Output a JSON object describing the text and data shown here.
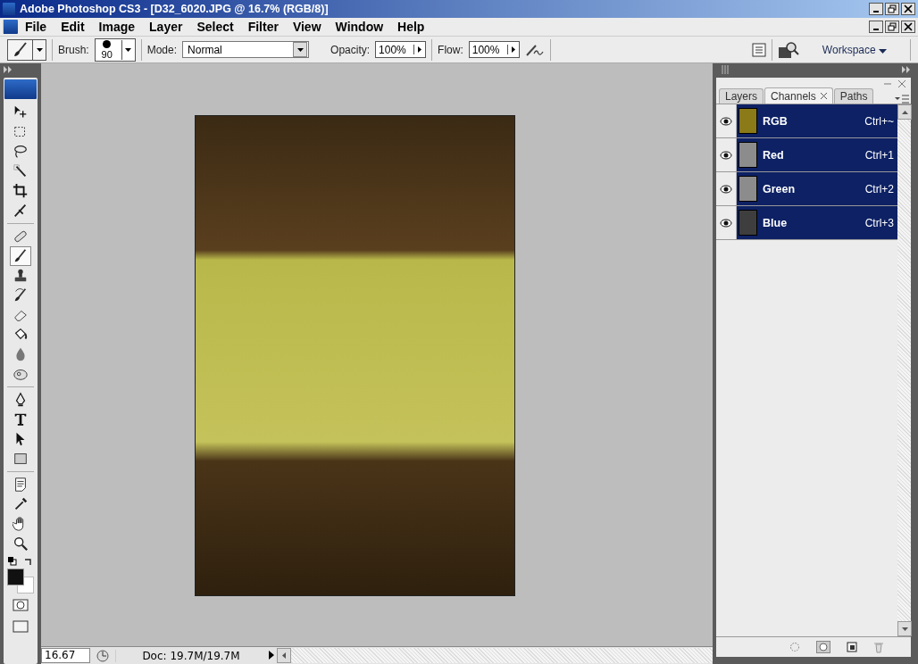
{
  "window": {
    "title": "Adobe Photoshop CS3 - [D32_6020.JPG @ 16.7% (RGB/8)]"
  },
  "menu": [
    "File",
    "Edit",
    "Image",
    "Layer",
    "Select",
    "Filter",
    "View",
    "Window",
    "Help"
  ],
  "options_bar": {
    "brush_label": "Brush:",
    "brush_size": "90",
    "mode_label": "Mode:",
    "mode": "Normal",
    "opacity_label": "Opacity:",
    "opacity": "100%",
    "flow_label": "Flow:",
    "flow": "100%",
    "workspace": "Workspace"
  },
  "tool_groups": [
    {
      "tools": [
        {
          "kind": "move",
          "selected": false
        },
        {
          "kind": "marquee",
          "selected": false
        },
        {
          "kind": "lasso",
          "selected": false
        },
        {
          "kind": "wand",
          "selected": false
        },
        {
          "kind": "crop",
          "selected": false
        },
        {
          "kind": "slice",
          "selected": false
        }
      ]
    },
    {
      "tools": [
        {
          "kind": "bandage",
          "selected": false
        },
        {
          "kind": "brush",
          "selected": true
        },
        {
          "kind": "stamp",
          "selected": false
        },
        {
          "kind": "history",
          "selected": false
        },
        {
          "kind": "eraser",
          "selected": false
        },
        {
          "kind": "bucket",
          "selected": false
        },
        {
          "kind": "drop",
          "selected": false
        },
        {
          "kind": "sponge",
          "selected": false
        }
      ]
    },
    {
      "tools": [
        {
          "kind": "pen",
          "selected": false
        },
        {
          "kind": "type",
          "selected": false
        },
        {
          "kind": "arrow",
          "selected": false
        },
        {
          "kind": "rectangle",
          "selected": false
        }
      ]
    },
    {
      "tools": [
        {
          "kind": "note",
          "selected": false
        },
        {
          "kind": "eyedropper",
          "selected": false
        },
        {
          "kind": "hand",
          "selected": false
        },
        {
          "kind": "zoom",
          "selected": false
        }
      ]
    }
  ],
  "status_bar": {
    "zoom": "16.67",
    "doc": "Doc: 19.7M/19.7M"
  },
  "panel": {
    "tabs": [
      {
        "label": "Layers",
        "selected": false
      },
      {
        "label": "Channels",
        "selected": true,
        "closable": true
      },
      {
        "label": "Paths",
        "selected": false
      }
    ],
    "channels": [
      {
        "name": "RGB",
        "shortcut": "Ctrl+~",
        "visible": true,
        "selected": true,
        "kind": "color"
      },
      {
        "name": "Red",
        "shortcut": "Ctrl+1",
        "visible": true,
        "selected": true,
        "kind": "gray"
      },
      {
        "name": "Green",
        "shortcut": "Ctrl+2",
        "visible": true,
        "selected": true,
        "kind": "gray"
      },
      {
        "name": "Blue",
        "shortcut": "Ctrl+3",
        "visible": true,
        "selected": true,
        "kind": "dark"
      }
    ]
  }
}
